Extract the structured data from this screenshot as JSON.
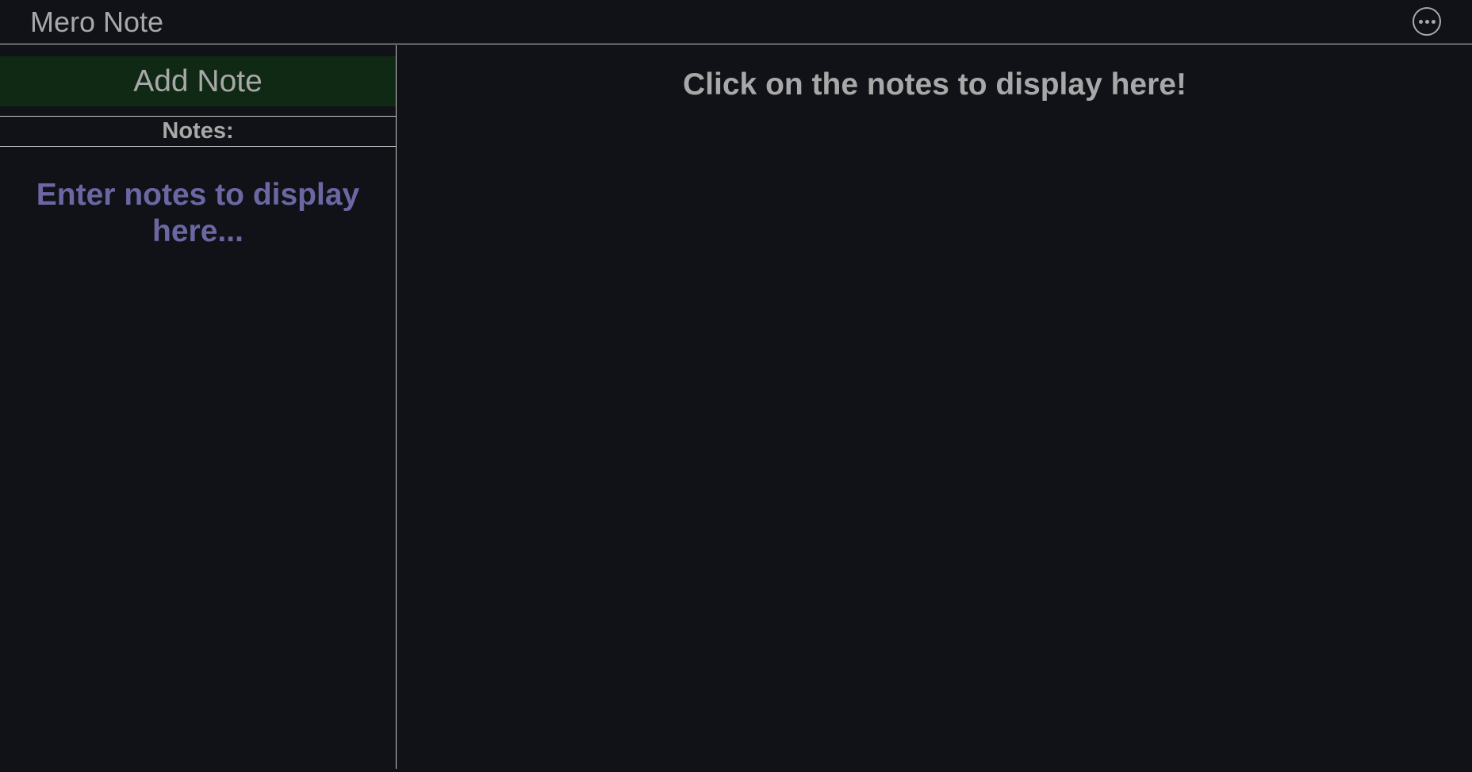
{
  "header": {
    "title": "Mero Note",
    "menu_icon": "more-horizontal-icon"
  },
  "sidebar": {
    "add_note_label": "Add Note",
    "notes_heading": "Notes:",
    "empty_message": "Enter notes to display here...",
    "add_note_color": "#0f2914",
    "empty_message_color": "#6c67a3"
  },
  "main": {
    "message": "Click on the notes to display here!"
  },
  "theme": {
    "background": "#101218",
    "text": "#a8a8a8",
    "divider": "#c8c8c8"
  }
}
